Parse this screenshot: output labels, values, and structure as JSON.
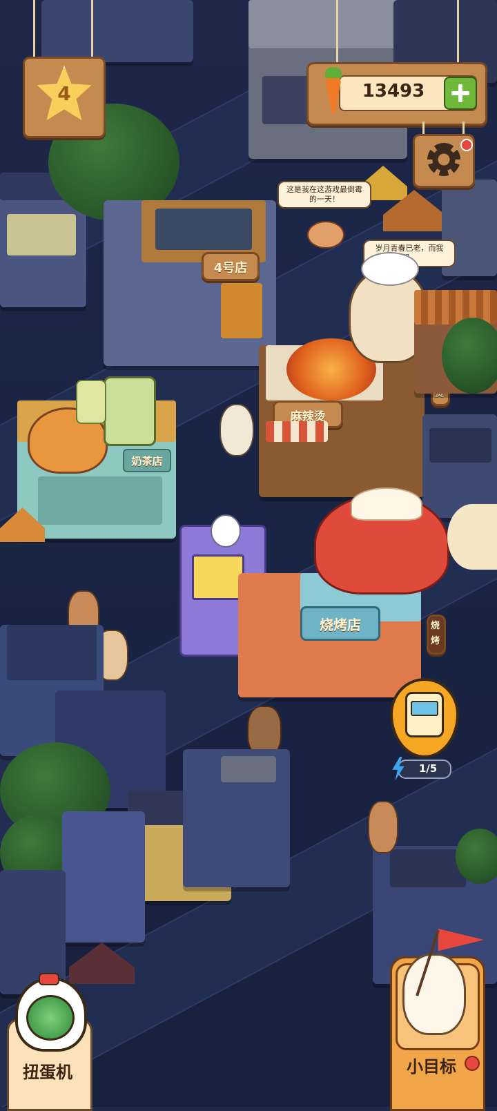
{
  "hud": {
    "level": "4",
    "carrot_count": "13493",
    "plus_icon": "plus-icon",
    "settings_icon": "gear-icon",
    "energy_text": "1/5"
  },
  "speech": {
    "bubble1": "这是我在这游戏最倒霉的一天！",
    "bubble2": "岁月青春已老，而我们，"
  },
  "shops": {
    "shop_4": "4号店",
    "spicy": "麻辣烫",
    "spicy_vertical": "麻辣烫",
    "milk_tea": "奶茶店",
    "bbq": "烧烤店",
    "bbq_vertical": "烧烤"
  },
  "bottom": {
    "left_label": "扭蛋机",
    "right_label": "小目标"
  },
  "colors": {
    "wood": "#c58a4f",
    "wood_dark": "#7a4a24",
    "plus_green": "#6fb83a",
    "notice_red": "#e8473e",
    "energy_blue": "#39a7f0"
  }
}
